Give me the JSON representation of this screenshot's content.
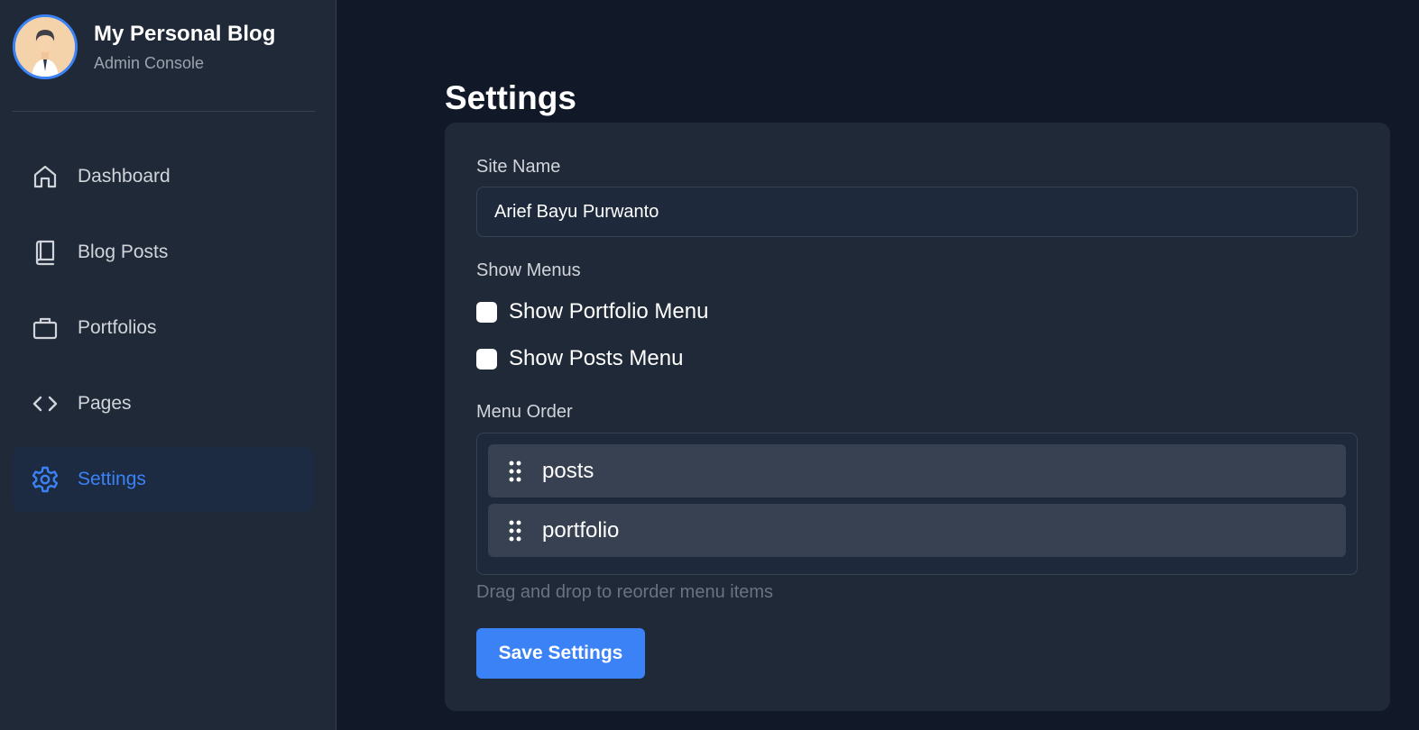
{
  "brand": {
    "title": "My Personal Blog",
    "subtitle": "Admin Console",
    "avatar_icon": "person-avatar"
  },
  "sidebar": {
    "items": [
      {
        "label": "Dashboard",
        "icon": "home-icon",
        "active": false
      },
      {
        "label": "Blog Posts",
        "icon": "book-icon",
        "active": false
      },
      {
        "label": "Portfolios",
        "icon": "briefcase-icon",
        "active": false
      },
      {
        "label": "Pages",
        "icon": "code-icon",
        "active": false
      },
      {
        "label": "Settings",
        "icon": "gear-icon",
        "active": true
      }
    ]
  },
  "main": {
    "title": "Settings",
    "site_name": {
      "label": "Site Name",
      "value": "Arief Bayu Purwanto"
    },
    "show_menus": {
      "label": "Show Menus",
      "options": [
        {
          "label": "Show Portfolio Menu",
          "checked": false
        },
        {
          "label": "Show Posts Menu",
          "checked": false
        }
      ]
    },
    "menu_order": {
      "label": "Menu Order",
      "items": [
        "posts",
        "portfolio"
      ],
      "hint": "Drag and drop to reorder menu items"
    },
    "save_label": "Save Settings"
  },
  "colors": {
    "background": "#111827",
    "sidebar": "#1f2937",
    "accent": "#3b82f6",
    "card": "#1f2937"
  }
}
